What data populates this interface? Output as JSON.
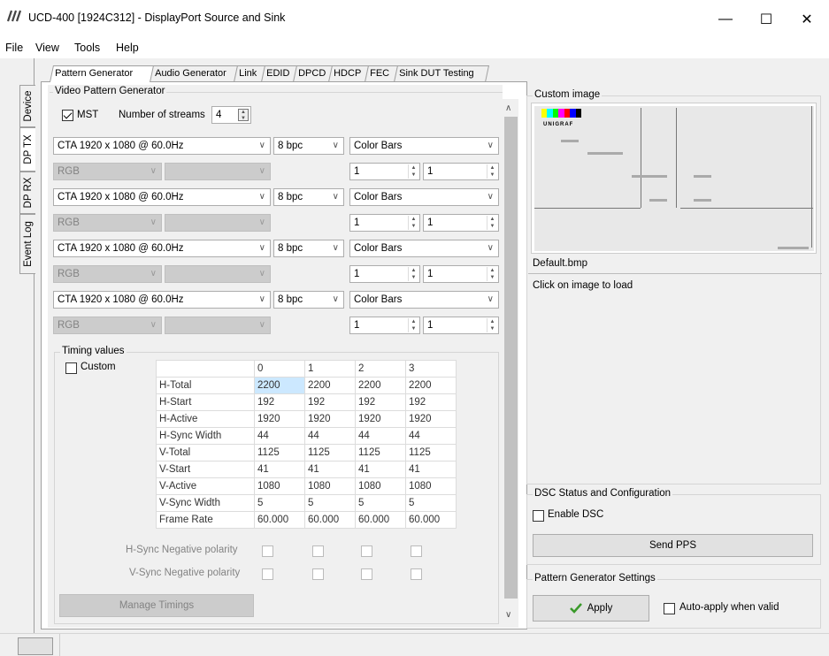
{
  "window": {
    "title": "UCD-400 [1924C312] - DisplayPort Source and Sink",
    "min": "—",
    "max": "☐",
    "close": "✕"
  },
  "menu": {
    "file": "File",
    "view": "View",
    "tools": "Tools",
    "help": "Help"
  },
  "top_tabs": [
    "Pattern Generator",
    "Audio Generator",
    "Link",
    "EDID",
    "DPCD",
    "HDCP",
    "FEC",
    "Sink DUT Testing"
  ],
  "side_tabs": [
    "Device",
    "DP TX",
    "DP RX",
    "Event Log"
  ],
  "vpg": {
    "title": "Video Pattern Generator",
    "mst_label": "MST",
    "streams_label": "Number of streams",
    "streams_value": "4",
    "rows": [
      {
        "timing": "CTA 1920 x 1080 @ 60.0Hz",
        "bpc": "8 bpc",
        "pattern": "Color Bars",
        "color": "RGB",
        "spin1": "1",
        "spin2": "1"
      },
      {
        "timing": "CTA 1920 x 1080 @ 60.0Hz",
        "bpc": "8 bpc",
        "pattern": "Color Bars",
        "color": "RGB",
        "spin1": "1",
        "spin2": "1"
      },
      {
        "timing": "CTA 1920 x 1080 @ 60.0Hz",
        "bpc": "8 bpc",
        "pattern": "Color Bars",
        "color": "RGB",
        "spin1": "1",
        "spin2": "1"
      },
      {
        "timing": "CTA 1920 x 1080 @ 60.0Hz",
        "bpc": "8 bpc",
        "pattern": "Color Bars",
        "color": "RGB",
        "spin1": "1",
        "spin2": "1"
      }
    ]
  },
  "timing": {
    "title": "Timing values",
    "custom_label": "Custom",
    "headers": [
      "",
      "0",
      "1",
      "2",
      "3"
    ],
    "rows": [
      [
        "H-Total",
        "2200",
        "2200",
        "2200",
        "2200"
      ],
      [
        "H-Start",
        "192",
        "192",
        "192",
        "192"
      ],
      [
        "H-Active",
        "1920",
        "1920",
        "1920",
        "1920"
      ],
      [
        "H-Sync Width",
        "44",
        "44",
        "44",
        "44"
      ],
      [
        "V-Total",
        "1125",
        "1125",
        "1125",
        "1125"
      ],
      [
        "V-Start",
        "41",
        "41",
        "41",
        "41"
      ],
      [
        "V-Active",
        "1080",
        "1080",
        "1080",
        "1080"
      ],
      [
        "V-Sync Width",
        "5",
        "5",
        "5",
        "5"
      ],
      [
        "Frame Rate",
        "60.000",
        "60.000",
        "60.000",
        "60.000"
      ]
    ],
    "hsync_neg": "H-Sync Negative polarity",
    "vsync_neg": "V-Sync Negative polarity",
    "manage_btn": "Manage Timings"
  },
  "custom_image": {
    "title": "Custom image",
    "logo_text": "UNIGRAF",
    "filename": "Default.bmp",
    "hint": "Click on image to load"
  },
  "dsc": {
    "title": "DSC Status and Configuration",
    "enable_label": "Enable DSC",
    "send_pps": "Send PPS"
  },
  "pgs": {
    "title": "Pattern Generator Settings",
    "apply": "Apply",
    "auto_apply": "Auto-apply when valid"
  }
}
